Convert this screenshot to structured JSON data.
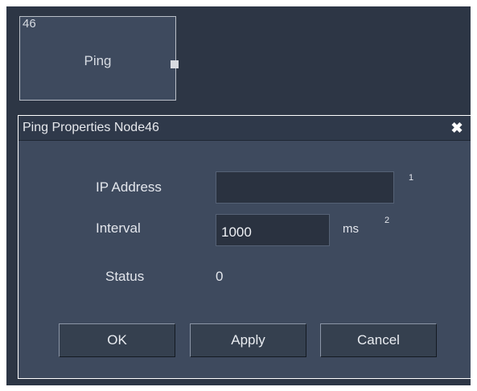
{
  "node": {
    "id": "46",
    "title": "Ping"
  },
  "dialog": {
    "title": "Ping Properties Node46",
    "close_glyph": "✖",
    "fields": {
      "ip_address": {
        "label": "IP Address",
        "value": "",
        "hint_number": "1"
      },
      "interval": {
        "label": "Interval",
        "value": "1000",
        "unit": "ms",
        "hint_number": "2"
      },
      "status": {
        "label": "Status",
        "value": "0"
      }
    },
    "buttons": {
      "ok": "OK",
      "apply": "Apply",
      "cancel": "Cancel"
    }
  },
  "colors": {
    "canvas": "#2d3645",
    "panel": "#3e4a5e",
    "input": "#2a3240",
    "text": "#e3e6ec"
  }
}
